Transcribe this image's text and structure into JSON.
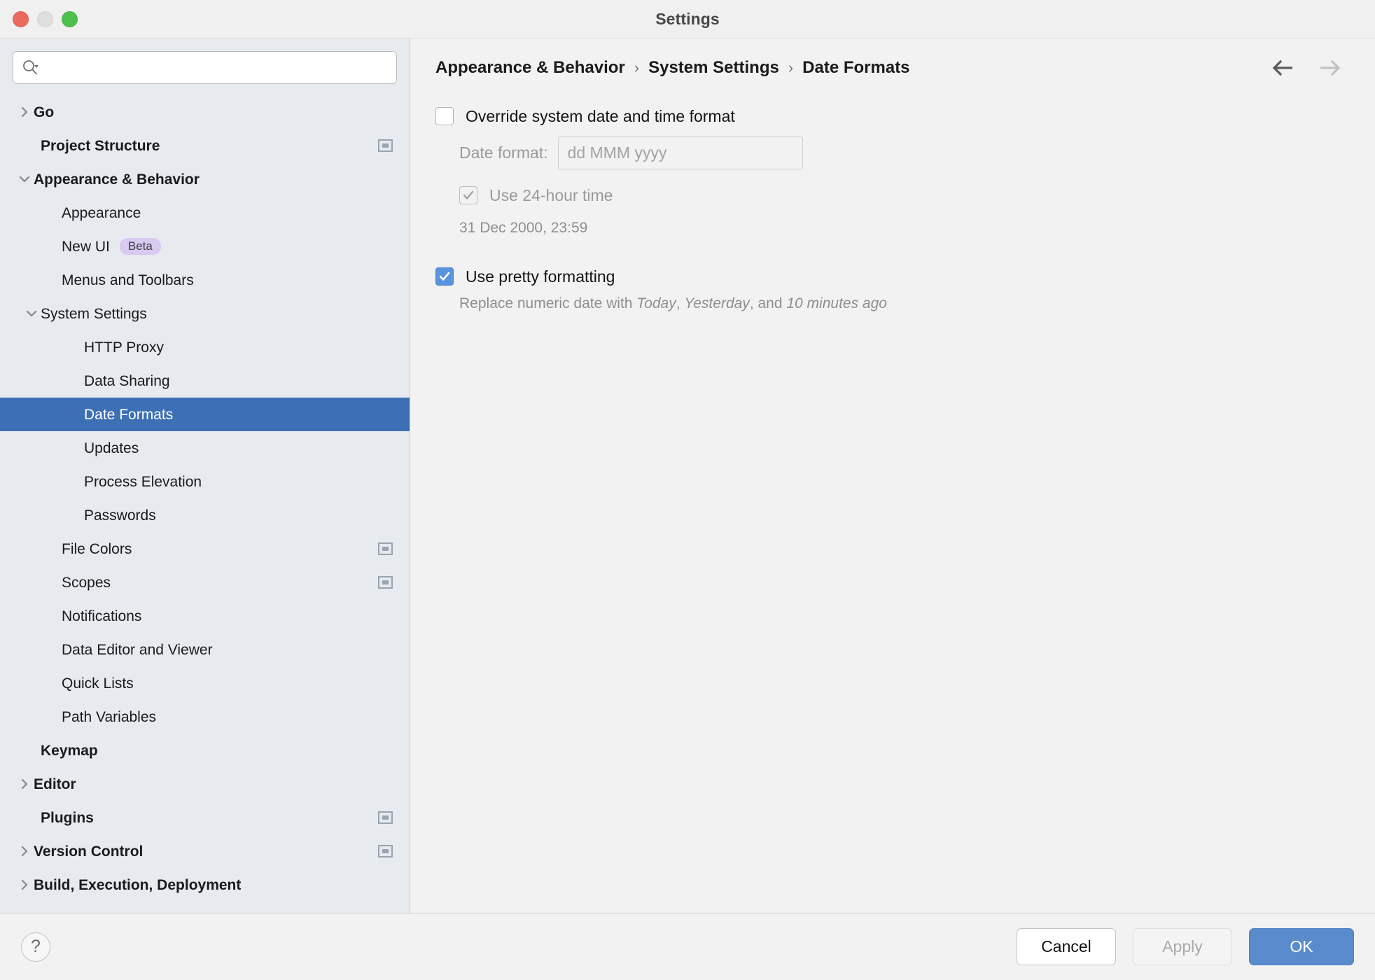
{
  "window": {
    "title": "Settings",
    "traffic_lights": [
      "close",
      "minimize",
      "zoom"
    ]
  },
  "sidebar": {
    "search": {
      "value": "",
      "placeholder": "",
      "icon": "search-icon"
    },
    "items": [
      {
        "label": "Go",
        "indent": 0,
        "bold": true,
        "arrow": "right",
        "panel_icon": false
      },
      {
        "label": "Project Structure",
        "indent": 0,
        "bold": true,
        "arrow": "none",
        "panel_icon": true
      },
      {
        "label": "Appearance & Behavior",
        "indent": 0,
        "bold": true,
        "arrow": "down",
        "panel_icon": false
      },
      {
        "label": "Appearance",
        "indent": 1,
        "bold": false,
        "arrow": "none",
        "panel_icon": false
      },
      {
        "label": "New UI",
        "indent": 1,
        "bold": false,
        "arrow": "none",
        "panel_icon": false,
        "badge": "Beta"
      },
      {
        "label": "Menus and Toolbars",
        "indent": 1,
        "bold": false,
        "arrow": "none",
        "panel_icon": false
      },
      {
        "label": "System Settings",
        "indent": 1,
        "bold": false,
        "arrow": "down",
        "panel_icon": false
      },
      {
        "label": "HTTP Proxy",
        "indent": 2,
        "bold": false,
        "arrow": "none",
        "panel_icon": false
      },
      {
        "label": "Data Sharing",
        "indent": 2,
        "bold": false,
        "arrow": "none",
        "panel_icon": false
      },
      {
        "label": "Date Formats",
        "indent": 2,
        "bold": false,
        "arrow": "none",
        "panel_icon": false,
        "selected": true
      },
      {
        "label": "Updates",
        "indent": 2,
        "bold": false,
        "arrow": "none",
        "panel_icon": false
      },
      {
        "label": "Process Elevation",
        "indent": 2,
        "bold": false,
        "arrow": "none",
        "panel_icon": false
      },
      {
        "label": "Passwords",
        "indent": 2,
        "bold": false,
        "arrow": "none",
        "panel_icon": false
      },
      {
        "label": "File Colors",
        "indent": 1,
        "bold": false,
        "arrow": "none",
        "panel_icon": true
      },
      {
        "label": "Scopes",
        "indent": 1,
        "bold": false,
        "arrow": "none",
        "panel_icon": true
      },
      {
        "label": "Notifications",
        "indent": 1,
        "bold": false,
        "arrow": "none",
        "panel_icon": false
      },
      {
        "label": "Data Editor and Viewer",
        "indent": 1,
        "bold": false,
        "arrow": "none",
        "panel_icon": false
      },
      {
        "label": "Quick Lists",
        "indent": 1,
        "bold": false,
        "arrow": "none",
        "panel_icon": false
      },
      {
        "label": "Path Variables",
        "indent": 1,
        "bold": false,
        "arrow": "none",
        "panel_icon": false
      },
      {
        "label": "Keymap",
        "indent": 0,
        "bold": true,
        "arrow": "none",
        "panel_icon": false
      },
      {
        "label": "Editor",
        "indent": 0,
        "bold": true,
        "arrow": "right",
        "panel_icon": false
      },
      {
        "label": "Plugins",
        "indent": 0,
        "bold": true,
        "arrow": "none",
        "panel_icon": true
      },
      {
        "label": "Version Control",
        "indent": 0,
        "bold": true,
        "arrow": "right",
        "panel_icon": true
      },
      {
        "label": "Build, Execution, Deployment",
        "indent": 0,
        "bold": true,
        "arrow": "right",
        "panel_icon": false
      }
    ]
  },
  "breadcrumb": {
    "items": [
      "Appearance & Behavior",
      "System Settings",
      "Date Formats"
    ],
    "separator": "›",
    "back_icon": "arrow-left-icon",
    "forward_icon": "arrow-right-icon",
    "back_enabled": true,
    "forward_enabled": false
  },
  "main": {
    "override": {
      "label": "Override system date and time format",
      "checked": false
    },
    "date_format": {
      "label": "Date format:",
      "value": "dd MMM yyyy",
      "placeholder": "dd MMM yyyy",
      "disabled": true
    },
    "use_24h": {
      "label": "Use 24-hour time",
      "checked": true,
      "disabled": true
    },
    "preview": "31 Dec 2000, 23:59",
    "pretty": {
      "label": "Use pretty formatting",
      "checked": true,
      "hint_prefix": "Replace numeric date with ",
      "hint_today": "Today",
      "hint_comma1": ", ",
      "hint_yesterday": "Yesterday",
      "hint_and": ", and ",
      "hint_ago": "10 minutes ago"
    }
  },
  "footer": {
    "help_label": "?",
    "cancel_label": "Cancel",
    "apply_label": "Apply",
    "ok_label": "OK",
    "apply_enabled": false
  },
  "colors": {
    "selection_blue": "#3d6fb5",
    "accent_blue": "#5a8ccd",
    "checkbox_blue": "#5a93de",
    "sidebar_bg": "#e7eaef",
    "main_bg": "#f2f2f2",
    "badge_bg": "#d9caf2"
  }
}
